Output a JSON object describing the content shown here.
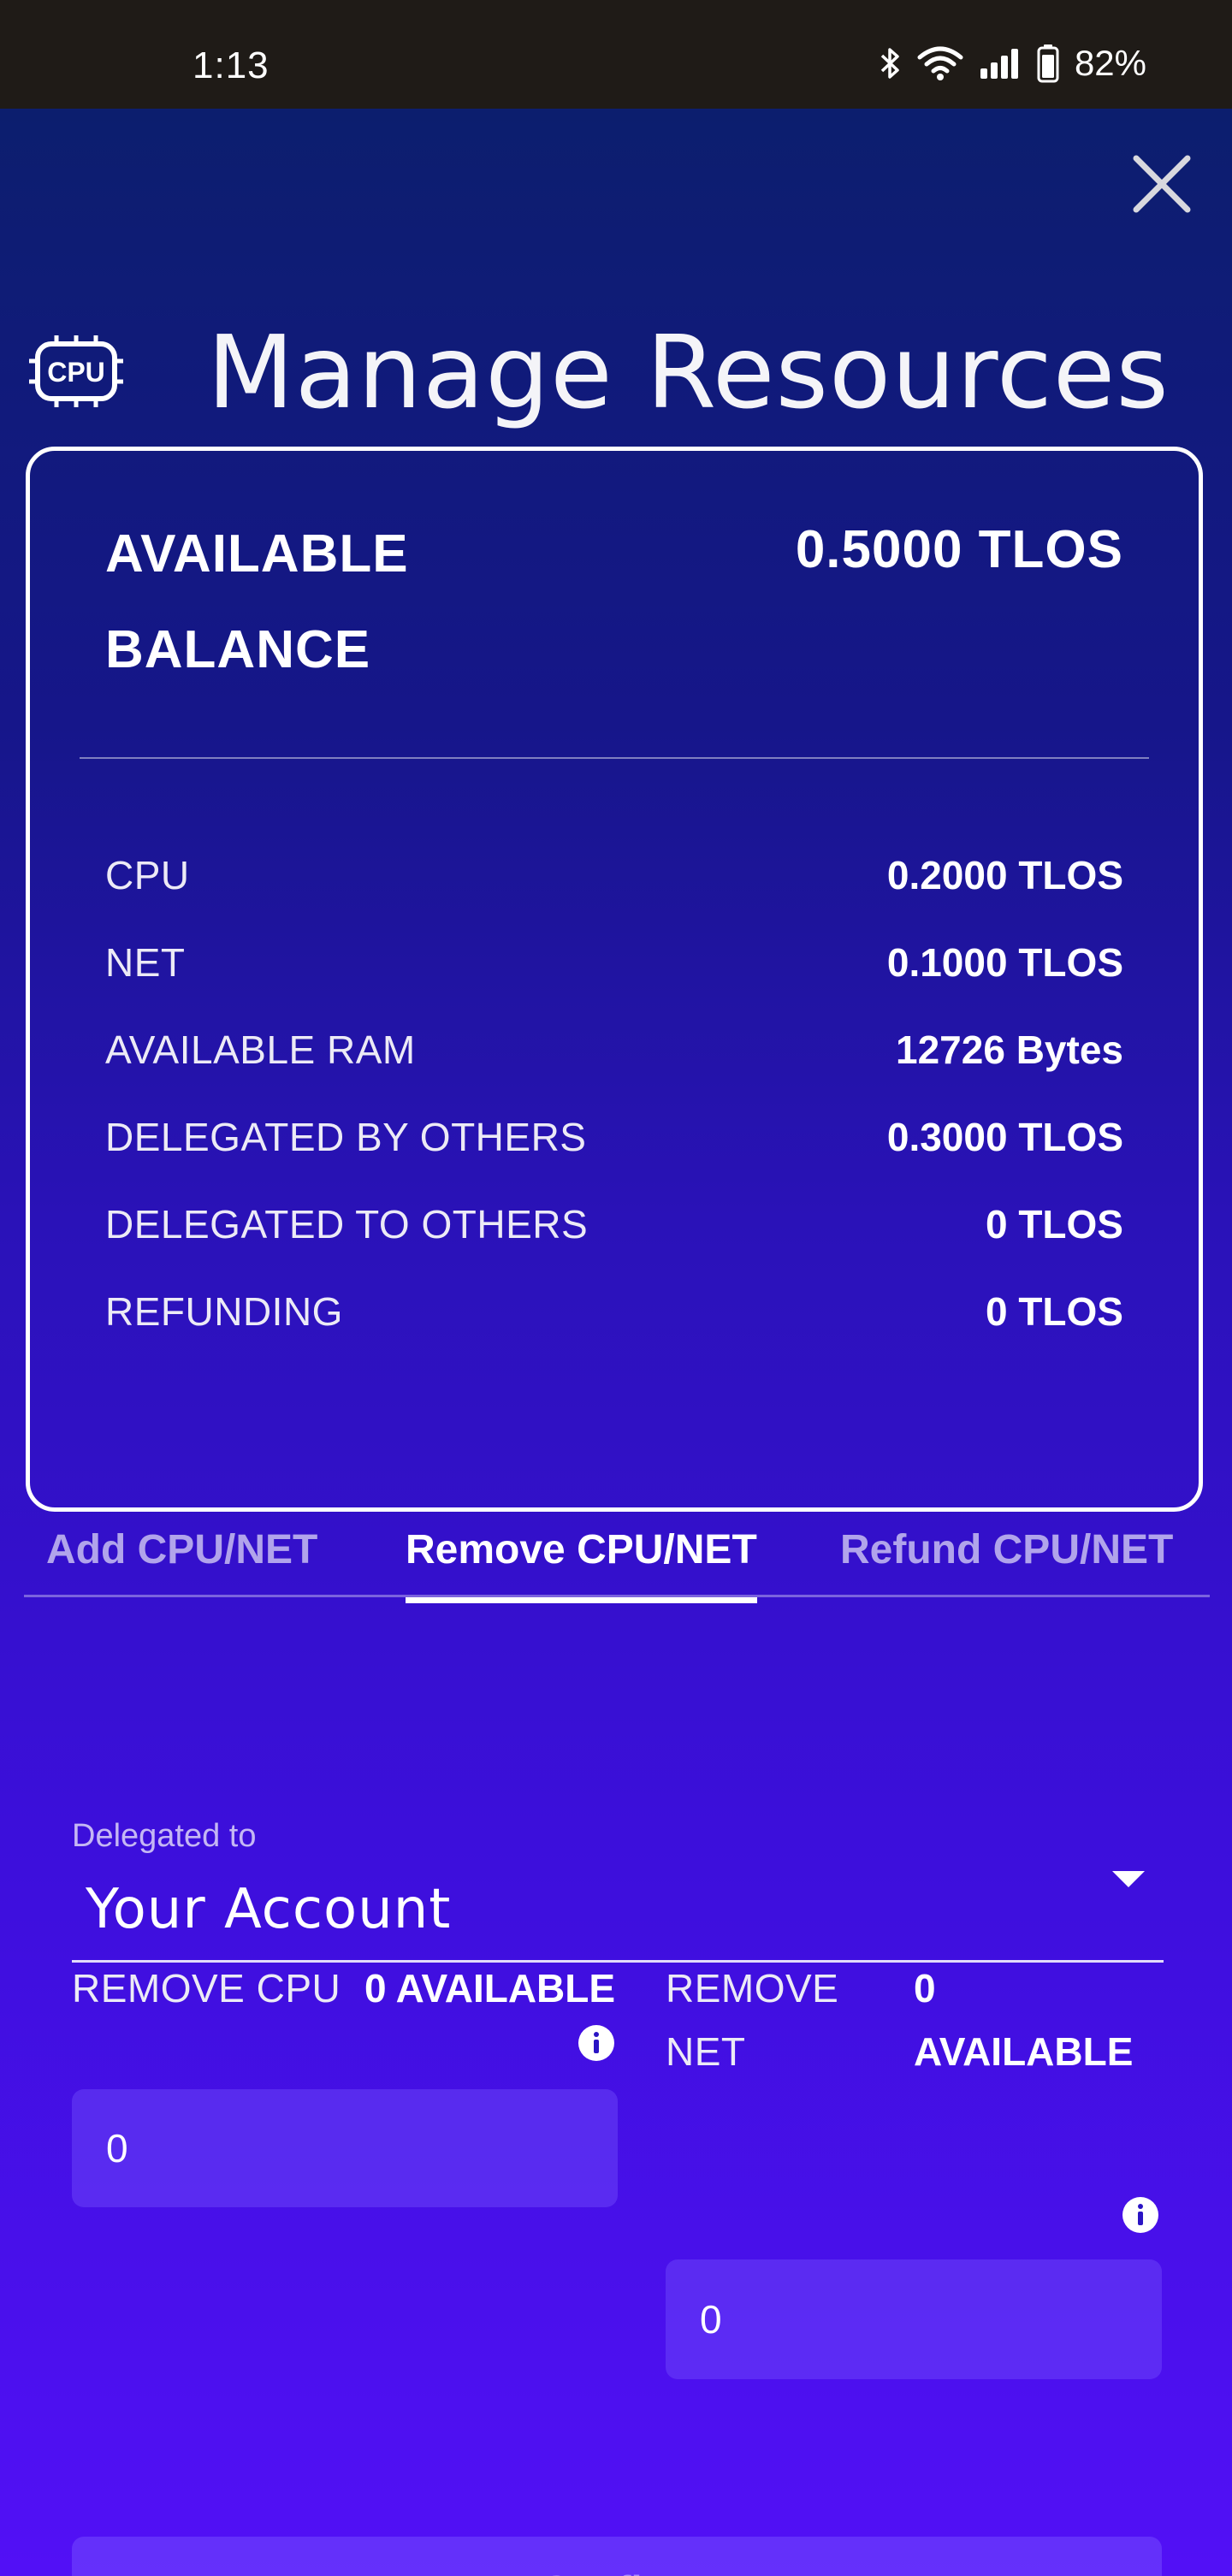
{
  "status_bar": {
    "time": "1:13",
    "battery": "82%",
    "icons": [
      "bluetooth-icon",
      "wifi-icon",
      "signal-icon",
      "battery-icon"
    ]
  },
  "header": {
    "title": "Manage Resources",
    "icon": "cpu-icon",
    "icon_text": "CPU",
    "close_icon": "close-icon"
  },
  "balance": {
    "label": "AVAILABLE BALANCE",
    "value": "0.5000 TLOS",
    "rows": [
      {
        "label": "CPU",
        "value": "0.2000 TLOS"
      },
      {
        "label": "NET",
        "value": "0.1000 TLOS"
      },
      {
        "label": "AVAILABLE RAM",
        "value": "12726 Bytes"
      },
      {
        "label": "DELEGATED BY OTHERS",
        "value": "0.3000 TLOS"
      },
      {
        "label": "DELEGATED TO OTHERS",
        "value": "0 TLOS"
      },
      {
        "label": "REFUNDING",
        "value": "0 TLOS"
      }
    ]
  },
  "tabs": [
    {
      "label": "Add CPU/NET",
      "active": false
    },
    {
      "label": "Remove CPU/NET",
      "active": true
    },
    {
      "label": "Refund CPU/NET",
      "active": false
    }
  ],
  "delegated": {
    "label": "Delegated to",
    "value": "Your Account"
  },
  "remove_cpu": {
    "label": "REMOVE CPU",
    "available": "0 AVAILABLE",
    "value": "0"
  },
  "remove_net": {
    "label": "REMOVE NET",
    "available_count": "0",
    "available_word": "AVAILABLE",
    "value": "0"
  },
  "confirm_label": "Confirm",
  "colors": {
    "status_bar_bg": "#1f1b17",
    "gradient_top": "#0c1e6e",
    "gradient_bottom": "#5210f6",
    "text": "#ffffff"
  }
}
